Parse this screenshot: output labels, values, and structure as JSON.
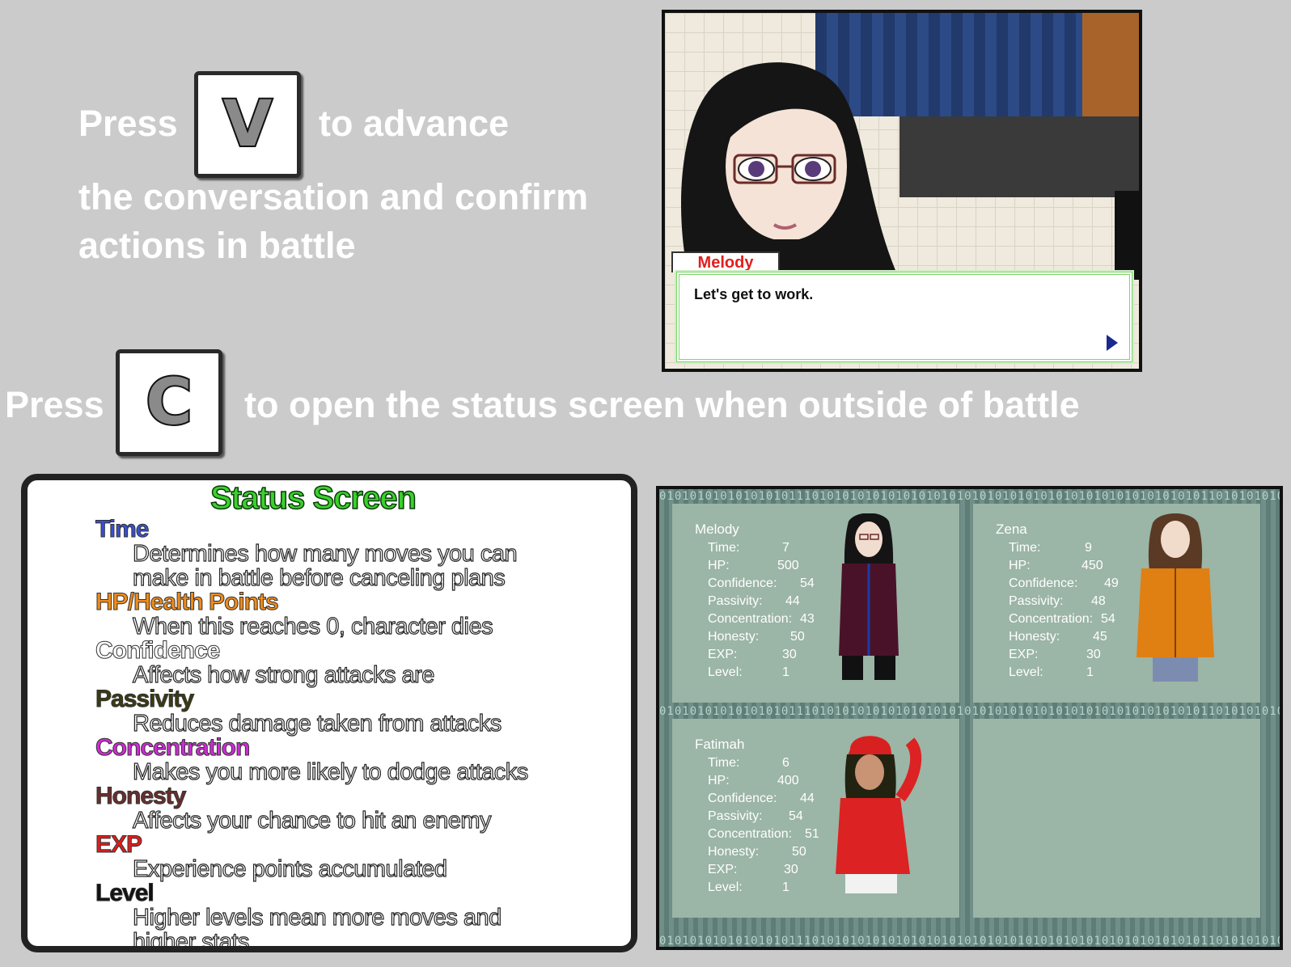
{
  "instruction_v": {
    "press": "Press",
    "key": "V",
    "line1": "to advance",
    "line2": "the conversation and confirm",
    "line3": "actions in battle"
  },
  "instruction_c": {
    "press": "Press",
    "key": "C",
    "text": "to open the status screen when outside of battle"
  },
  "dialogue": {
    "speaker": "Melody",
    "text": "Let's get to work."
  },
  "status_screen": {
    "title": "Status Screen",
    "entries": [
      {
        "name": "Time",
        "color": "#3a4fd0",
        "desc1": "Determines how many moves you can",
        "desc2": "make in battle before canceling plans"
      },
      {
        "name": "HP/Health Points",
        "color": "#f08c1a",
        "desc1": "When this reaches 0, character dies",
        "desc2": ""
      },
      {
        "name": "Confidence",
        "color": "#ffffff",
        "desc1": "Affects how strong attacks are",
        "desc2": ""
      },
      {
        "name": "Passivity",
        "color": "#3b3b10",
        "desc1": "Reduces damage taken from attacks",
        "desc2": ""
      },
      {
        "name": "Concentration",
        "color": "#d12ad8",
        "desc1": "Makes you more likely to dodge attacks",
        "desc2": ""
      },
      {
        "name": "Honesty",
        "color": "#6b2d2d",
        "desc1": "Affects your chance to hit an enemy",
        "desc2": ""
      },
      {
        "name": "EXP",
        "color": "#e01c1c",
        "desc1": "Experience points accumulated",
        "desc2": ""
      },
      {
        "name": "Level",
        "color": "#111111",
        "desc1": "Higher levels mean more moves and",
        "desc2": "higher stats"
      }
    ]
  },
  "stat_labels": [
    "Time:",
    "HP:",
    "Confidence:",
    "Passivity:",
    "Concentration:",
    "Honesty:",
    "EXP:",
    "Level:"
  ],
  "party": [
    {
      "name": "Melody",
      "values": [
        "7",
        "500",
        "54",
        "44",
        "43",
        "50",
        "30",
        "1"
      ]
    },
    {
      "name": "Zena",
      "values": [
        "9",
        "450",
        "49",
        "48",
        "54",
        "45",
        "30",
        "1"
      ]
    },
    {
      "name": "Fatimah",
      "values": [
        "6",
        "400",
        "44",
        "54",
        "51",
        "50",
        "30",
        "1"
      ]
    }
  ],
  "binary_strip": "0101010101010101011101010101010101010101010101010101010101010101010101011010101010101"
}
